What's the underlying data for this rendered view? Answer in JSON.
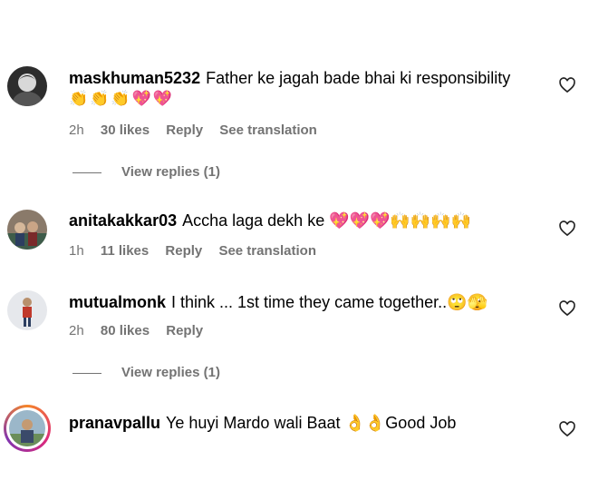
{
  "comments": [
    {
      "username": "maskhuman5232",
      "text": "Father ke jagah bade bhai ki responsibility",
      "emoji": "👏👏👏💖💖",
      "time": "2h",
      "likes": "30 likes",
      "reply": "Reply",
      "translate": "See translation",
      "view_replies": "View replies (1)"
    },
    {
      "username": "anitakakkar03",
      "text": "Accha laga dekh ke 💖💖💖🙌🙌🙌🙌",
      "time": "1h",
      "likes": "11 likes",
      "reply": "Reply",
      "translate": "See translation"
    },
    {
      "username": "mutualmonk",
      "text": "I think ... 1st time they came together..🙄🫣",
      "time": "2h",
      "likes": "80 likes",
      "reply": "Reply",
      "view_replies": "View replies (1)"
    },
    {
      "username": "pranavpallu",
      "text": "Ye huyi Mardo wali Baat 👌👌Good Job"
    }
  ]
}
